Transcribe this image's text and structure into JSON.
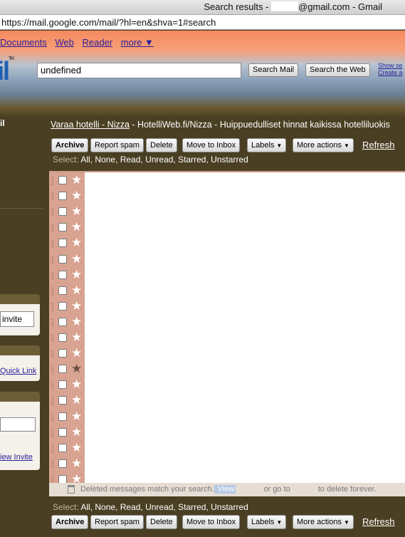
{
  "window": {
    "title_prefix": "Search results -",
    "title_suffix": "@gmail.com - Gmail"
  },
  "url": "https://mail.google.com/mail/?hl=en&shva=1#search",
  "topnav": [
    "Documents",
    "Web",
    "Reader",
    "more ▼"
  ],
  "logo": {
    "text": "il",
    "tm": "TM"
  },
  "search": {
    "value": "undefined",
    "btn_mail": "Search Mail",
    "btn_web": "Search the Web"
  },
  "header_links": [
    "Show se",
    "Create a"
  ],
  "sidebar": {
    "partial_label": "il",
    "invite_value": "invite",
    "quick_link": "Quick Link",
    "view_invite": "iew Invite"
  },
  "ad": {
    "link_text": "Varaa hotelli - Nizza",
    "rest": " - HotelliWeb.fi/Nizza - Huippuedulliset hinnat kaikissa hotelliluokis"
  },
  "toolbar": {
    "archive": "Archive",
    "report_spam": "Report spam",
    "delete": "Delete",
    "move_inbox": "Move to Inbox",
    "labels": "Labels",
    "more_actions": "More actions",
    "refresh": "Refresh",
    "dropdown_arrow": "▼"
  },
  "select": {
    "label": "Select:",
    "options": "All, None, Read, Unread, Starred, Unstarred"
  },
  "rows": [
    {
      "starred": false
    },
    {
      "starred": false
    },
    {
      "starred": false
    },
    {
      "starred": false
    },
    {
      "starred": false
    },
    {
      "starred": false
    },
    {
      "starred": false
    },
    {
      "starred": false
    },
    {
      "starred": false
    },
    {
      "starred": false
    },
    {
      "starred": false
    },
    {
      "starred": false
    },
    {
      "starred": true
    },
    {
      "starred": false
    },
    {
      "starred": false
    },
    {
      "starred": false
    },
    {
      "starred": false
    },
    {
      "starred": false
    },
    {
      "starred": false
    },
    {
      "starred": false
    }
  ],
  "footer_msg": {
    "part1": "Deleted messages match your search.",
    "view_link": " View",
    "part2": "or go to",
    "part3": "to delete forever."
  },
  "colors": {
    "header_top": "#f58a5f",
    "background": "#4a3f22",
    "link": "#2a1e9a",
    "row_bg": "#d9a391"
  }
}
